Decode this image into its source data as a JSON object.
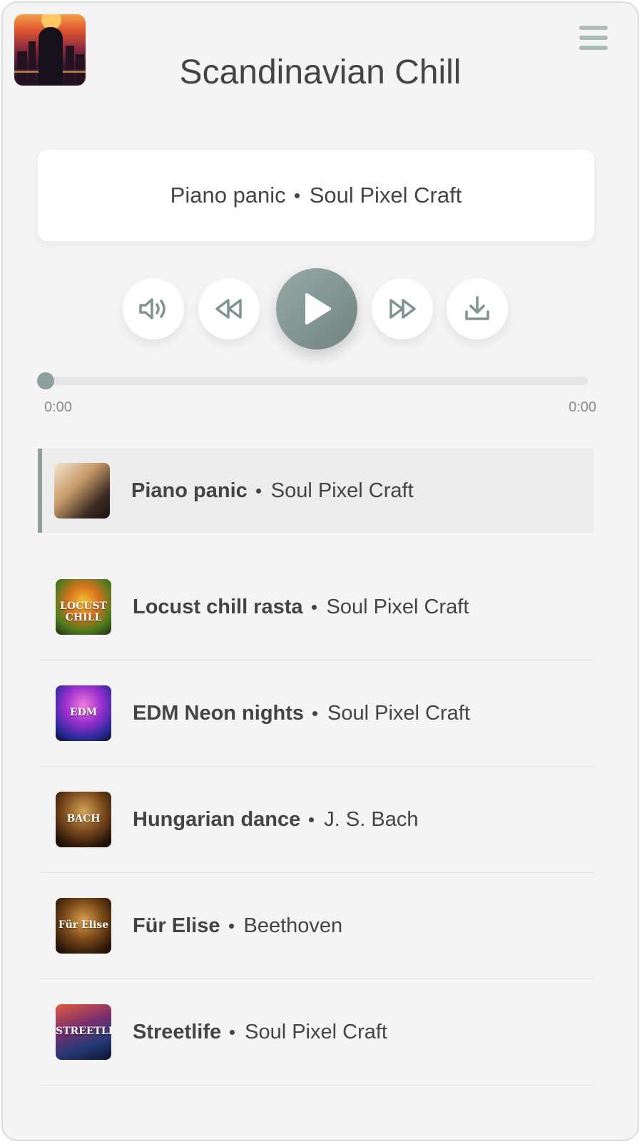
{
  "app": {
    "title": "Scandinavian Chill",
    "cover_icon": "playlist-cover-image",
    "menu_icon": "hamburger-menu-icon"
  },
  "now_playing": {
    "title": "Piano panic",
    "artist": "Soul Pixel Craft"
  },
  "controls": {
    "volume_icon": "volume-icon",
    "rewind_icon": "rewind-icon",
    "play_icon": "play-icon",
    "forward_icon": "fast-forward-icon",
    "download_icon": "download-icon",
    "accent": "#7f9391"
  },
  "progress": {
    "current": "0:00",
    "duration": "0:00",
    "fraction": 0
  },
  "playlist": [
    {
      "title": "Piano panic",
      "artist": "Soul Pixel Craft",
      "active": true
    },
    {
      "title": "Locust chill rasta",
      "artist": "Soul Pixel Craft",
      "thumb_text": "LOCUST CHILL"
    },
    {
      "title": "EDM Neon nights",
      "artist": "Soul Pixel Craft",
      "thumb_text": "EDM"
    },
    {
      "title": "Hungarian dance",
      "artist": "J. S. Bach",
      "thumb_text": "BACH"
    },
    {
      "title": "Für Elise",
      "artist": "Beethoven",
      "thumb_text": "Für Elise"
    },
    {
      "title": "Streetlife",
      "artist": "Soul Pixel Craft",
      "thumb_text": "STREETLIFE"
    }
  ]
}
